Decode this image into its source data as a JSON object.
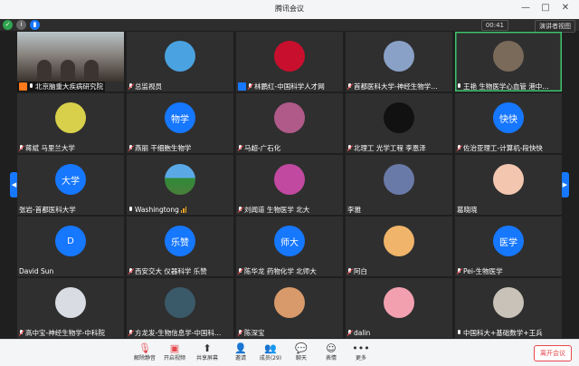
{
  "window": {
    "title": "腾讯会议"
  },
  "infobar": {
    "timer": "00:41",
    "speaker_view": "演讲者视图"
  },
  "tiles": [
    {
      "label": "北京脑重大疾病研究院",
      "type": "photo",
      "host": true,
      "mic": "on"
    },
    {
      "label": "总监视员",
      "type": "image",
      "color": "#4aa3e0",
      "mic": "muted"
    },
    {
      "label": "林鹏红-中国科学人才网",
      "type": "image",
      "color": "#c8102e",
      "admin": true,
      "mic": "muted"
    },
    {
      "label": "首都医科大学-神经生物学…",
      "type": "image",
      "color": "#8aa1c7",
      "mic": "muted"
    },
    {
      "label": "王艳 生物医学心血管 港中…",
      "type": "image",
      "color": "#7a6a5a",
      "mic": "on",
      "active": true
    },
    {
      "label": "蒋斌 马里兰大学",
      "type": "image",
      "color": "#d8d04a",
      "mic": "muted"
    },
    {
      "label": "燕丽 干细胞生物学",
      "type": "text",
      "avatar_text": "物学",
      "mic": "muted"
    },
    {
      "label": "马超-广石化",
      "type": "image",
      "color": "#b05a8a",
      "mic": "muted"
    },
    {
      "label": "北理工 光学工程 李恩泽",
      "type": "image",
      "color": "#111111",
      "mic": "muted"
    },
    {
      "label": "佐治亚理工-计算机-段快快",
      "type": "text",
      "avatar_text": "快快",
      "mic": "muted"
    },
    {
      "label": "张岩-首都医科大学",
      "type": "text",
      "avatar_text": "大学",
      "mic": "none"
    },
    {
      "label": "Washingtong",
      "type": "landscape",
      "mic": "on",
      "signal": true
    },
    {
      "label": "刘闻道 生物医学 北大",
      "type": "image",
      "color": "#c14aa0",
      "mic": "muted"
    },
    {
      "label": "李雅",
      "type": "image",
      "color": "#6a7aa8",
      "mic": "none"
    },
    {
      "label": "葛晓晓",
      "type": "image",
      "color": "#f3c6b0",
      "mic": "none"
    },
    {
      "label": "David Sun",
      "type": "text",
      "avatar_text": "D",
      "mic": "none"
    },
    {
      "label": "西安交大 仪器科学 乐赞",
      "type": "text",
      "avatar_text": "乐赞",
      "mic": "muted"
    },
    {
      "label": "陈华龙 药物化学 北师大",
      "type": "text",
      "avatar_text": "师大",
      "mic": "muted"
    },
    {
      "label": "阿白",
      "type": "image",
      "color": "#f0b46a",
      "mic": "muted"
    },
    {
      "label": "Pei-生物医学",
      "type": "text",
      "avatar_text": "医学",
      "mic": "muted"
    },
    {
      "label": "高中宝-神经生物学-中科院",
      "type": "image",
      "color": "#d9dde3",
      "mic": "muted"
    },
    {
      "label": "方龙发-生物信息学-中国科…",
      "type": "image",
      "color": "#3a5a6a",
      "mic": "muted"
    },
    {
      "label": "陈深宝",
      "type": "image",
      "color": "#d89a6a",
      "mic": "muted"
    },
    {
      "label": "dalin",
      "type": "image",
      "color": "#f2a0b0",
      "mic": "muted"
    },
    {
      "label": "中国科大+基础数学+王兵",
      "type": "image",
      "color": "#c9c2b8",
      "mic": "on"
    }
  ],
  "toolbar": {
    "items": [
      {
        "label": "解除静音",
        "icon": "microphone-icon"
      },
      {
        "label": "开启视频",
        "icon": "camera-icon"
      },
      {
        "label": "共享屏幕",
        "icon": "share-screen-icon"
      },
      {
        "label": "邀请",
        "icon": "invite-icon"
      },
      {
        "label": "成员(29)",
        "icon": "members-icon"
      },
      {
        "label": "聊天",
        "icon": "chat-icon"
      },
      {
        "label": "表情",
        "icon": "emoji-icon"
      },
      {
        "label": "更多",
        "icon": "more-icon"
      }
    ],
    "leave_label": "离开会议"
  }
}
